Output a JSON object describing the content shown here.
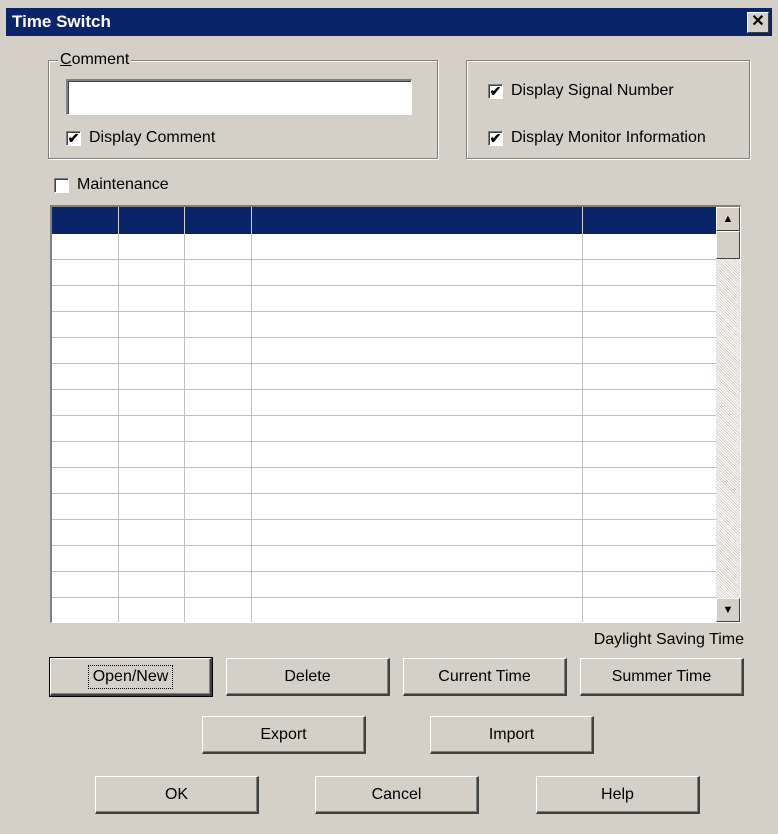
{
  "window": {
    "title": "Time Switch",
    "close_glyph": "✕"
  },
  "comment_group": {
    "legend": "Comment",
    "comment_value": "",
    "display_comment_label": "Display Comment",
    "display_comment_checked": true
  },
  "display_group": {
    "display_signal_number_label": "Display Signal Number",
    "display_signal_number_checked": true,
    "display_monitor_information_label": "Display Monitor Information",
    "display_monitor_information_checked": true
  },
  "maintenance": {
    "label": "Maintenance",
    "checked": false
  },
  "grid": {
    "columns": [
      "",
      "",
      "",
      "",
      ""
    ],
    "row_count": 15,
    "scroll_up_glyph": "▲",
    "scroll_down_glyph": "▼"
  },
  "daylight_saving_label": "Daylight Saving Time",
  "buttons": {
    "open_new": "Open/New",
    "delete": "Delete",
    "current_time": "Current Time",
    "summer_time": "Summer Time",
    "export": "Export",
    "import": "Import",
    "ok": "OK",
    "cancel": "Cancel",
    "help": "Help"
  },
  "colors": {
    "title_bar": "#0a246a",
    "face": "#d4d0c8",
    "grid_header": "#0a246a"
  }
}
